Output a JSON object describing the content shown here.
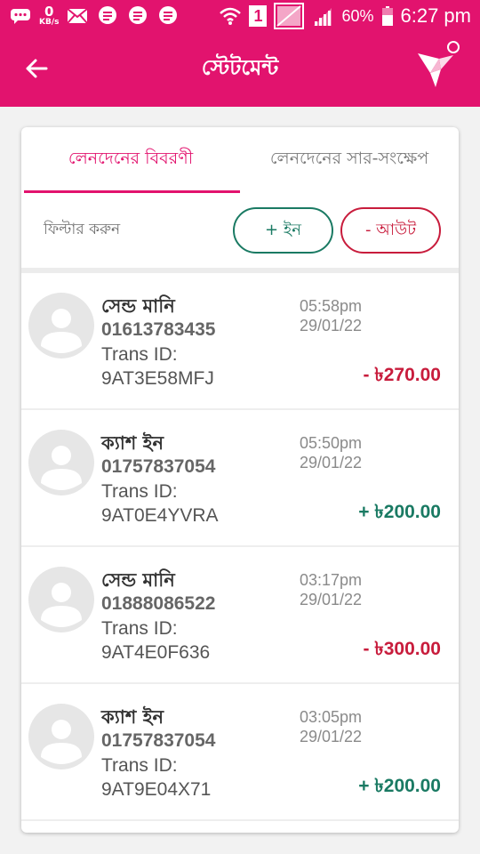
{
  "statusbar": {
    "speed_value": "0",
    "speed_unit": "KB/s",
    "sim": "1",
    "battery": "60%",
    "time": "6:27 pm"
  },
  "appbar": {
    "title": "স্টেটমেন্ট"
  },
  "tabs": [
    {
      "label": "লেনদেনের বিবরণী",
      "active": true
    },
    {
      "label": "লেনদেনের সার-সংক্ষেপ",
      "active": false
    }
  ],
  "filter": {
    "label": "ফিল্টার করুন",
    "in_label": "+  ইন",
    "out_label": "-  আউট"
  },
  "transactions": [
    {
      "name": "সেন্ড মানি",
      "phone": "01613783435",
      "trans_label": "Trans ID:",
      "trans_id": "9AT3E58MFJ",
      "time": "05:58pm",
      "date": "29/01/22",
      "amount": "- ৳270.00",
      "direction": "out"
    },
    {
      "name": "ক্যাশ ইন",
      "phone": "01757837054",
      "trans_label": "Trans ID:",
      "trans_id": "9AT0E4YVRA",
      "time": "05:50pm",
      "date": "29/01/22",
      "amount": "+ ৳200.00",
      "direction": "in"
    },
    {
      "name": "সেন্ড মানি",
      "phone": "01888086522",
      "trans_label": "Trans ID:",
      "trans_id": "9AT4E0F636",
      "time": "03:17pm",
      "date": "29/01/22",
      "amount": "- ৳300.00",
      "direction": "out"
    },
    {
      "name": "ক্যাশ ইন",
      "phone": "01757837054",
      "trans_label": "Trans ID:",
      "trans_id": "9AT9E04X71",
      "time": "03:05pm",
      "date": "29/01/22",
      "amount": "+ ৳200.00",
      "direction": "in"
    }
  ],
  "colors": {
    "brand": "#e2136e",
    "in": "#1a7a63",
    "out": "#c81c3c"
  }
}
